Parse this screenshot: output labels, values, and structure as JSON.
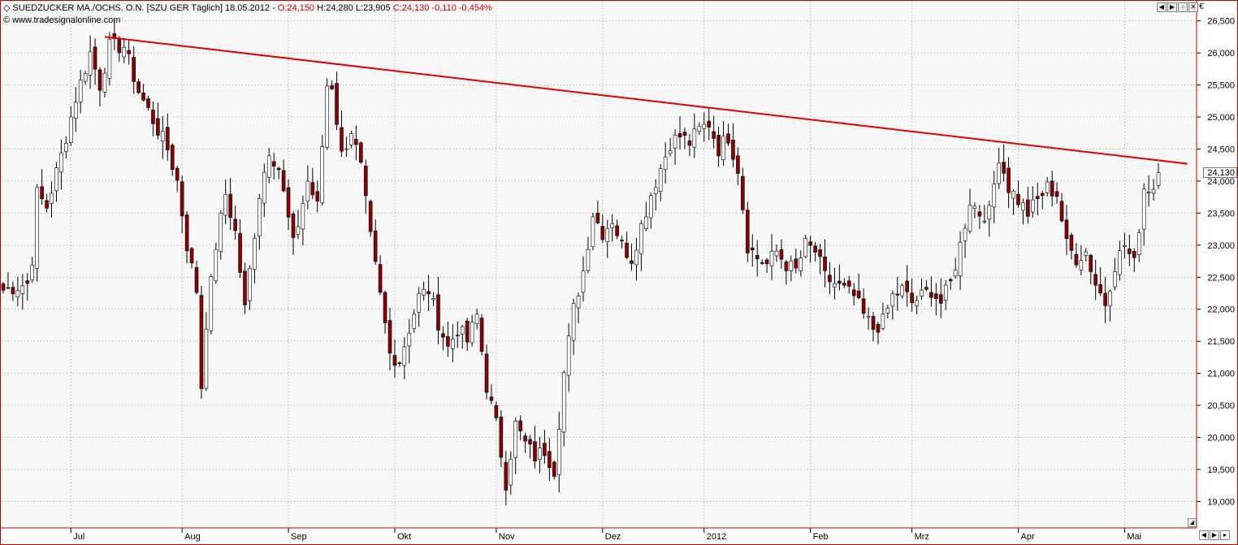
{
  "header": {
    "symbol": "SUEDZUCKER MA./OCHS. O.N.",
    "exchange": "[SZU GER  Täglich]",
    "date": "18.05.2012 -",
    "open": "O:24,150",
    "high": "H:24,280",
    "low": "L:23,905",
    "close_change": "C:24,130 -0,110 -0,454%"
  },
  "site": "www.tradesignalonline.com",
  "currency": "€",
  "last_price_label": "24,130",
  "colors": {
    "up": "#ffffff",
    "down": "#8b0000",
    "trendline": "#e00000",
    "border": "#c00000"
  },
  "chart_data": {
    "type": "candlestick",
    "ylim": [
      18600,
      26800
    ],
    "yticks": [
      19000,
      19500,
      20000,
      20500,
      21000,
      21500,
      22000,
      22500,
      23000,
      23500,
      24000,
      24500,
      25000,
      25500,
      26000,
      26500
    ],
    "ytick_labels": [
      "19,000",
      "19,500",
      "20,000",
      "20,500",
      "21,000",
      "21,500",
      "22,000",
      "22,500",
      "23,000",
      "23,500",
      "24,000",
      "24,500",
      "25,000",
      "25,500",
      "26,000",
      "26,500"
    ],
    "months": [
      {
        "label": "Jul",
        "day": 14
      },
      {
        "label": "Aug",
        "day": 37
      },
      {
        "label": "Sep",
        "day": 59
      },
      {
        "label": "Okt",
        "day": 81
      },
      {
        "label": "Nov",
        "day": 102
      },
      {
        "label": "Dez",
        "day": 124
      },
      {
        "label": "2012",
        "day": 145
      },
      {
        "label": "Feb",
        "day": 167
      },
      {
        "label": "Mrz",
        "day": 188
      },
      {
        "label": "Apr",
        "day": 210
      },
      {
        "label": "Mai",
        "day": 232
      }
    ],
    "total_days": 250,
    "trendline": {
      "from": [
        21,
        26250
      ],
      "to": [
        245,
        24270
      ]
    },
    "last_close": 24130,
    "anchors": [
      [
        0,
        22300
      ],
      [
        5,
        22400
      ],
      [
        6,
        22800
      ],
      [
        7,
        23800
      ],
      [
        9,
        23600
      ],
      [
        12,
        24400
      ],
      [
        15,
        25300
      ],
      [
        18,
        26000
      ],
      [
        20,
        25500
      ],
      [
        22,
        26100
      ],
      [
        25,
        26100
      ],
      [
        28,
        25400
      ],
      [
        30,
        25100
      ],
      [
        34,
        24500
      ],
      [
        36,
        24000
      ],
      [
        38,
        23000
      ],
      [
        40,
        22300
      ],
      [
        41,
        20800
      ],
      [
        42,
        21800
      ],
      [
        44,
        23000
      ],
      [
        46,
        23800
      ],
      [
        48,
        23200
      ],
      [
        50,
        22000
      ],
      [
        53,
        23800
      ],
      [
        55,
        24500
      ],
      [
        57,
        24200
      ],
      [
        60,
        23000
      ],
      [
        63,
        24000
      ],
      [
        65,
        23600
      ],
      [
        67,
        25500
      ],
      [
        68,
        25500
      ],
      [
        70,
        24400
      ],
      [
        72,
        24800
      ],
      [
        74,
        24200
      ],
      [
        76,
        23100
      ],
      [
        78,
        22200
      ],
      [
        80,
        21300
      ],
      [
        82,
        21200
      ],
      [
        84,
        21700
      ],
      [
        86,
        22200
      ],
      [
        88,
        22300
      ],
      [
        90,
        21800
      ],
      [
        92,
        21400
      ],
      [
        94,
        21700
      ],
      [
        96,
        21500
      ],
      [
        98,
        21900
      ],
      [
        100,
        20800
      ],
      [
        102,
        20200
      ],
      [
        104,
        19300
      ],
      [
        106,
        20200
      ],
      [
        108,
        19900
      ],
      [
        110,
        19700
      ],
      [
        112,
        19800
      ],
      [
        114,
        19500
      ],
      [
        116,
        21000
      ],
      [
        118,
        22000
      ],
      [
        120,
        22600
      ],
      [
        122,
        23500
      ],
      [
        124,
        23200
      ],
      [
        126,
        23400
      ],
      [
        128,
        23000
      ],
      [
        130,
        22800
      ],
      [
        132,
        23300
      ],
      [
        134,
        23800
      ],
      [
        136,
        24200
      ],
      [
        138,
        24600
      ],
      [
        140,
        24700
      ],
      [
        142,
        24600
      ],
      [
        144,
        24800
      ],
      [
        146,
        24900
      ],
      [
        148,
        24500
      ],
      [
        150,
        24700
      ],
      [
        152,
        24200
      ],
      [
        154,
        23000
      ],
      [
        156,
        22800
      ],
      [
        158,
        22700
      ],
      [
        160,
        22900
      ],
      [
        162,
        22700
      ],
      [
        164,
        22600
      ],
      [
        166,
        23000
      ],
      [
        168,
        22900
      ],
      [
        170,
        22500
      ],
      [
        172,
        22400
      ],
      [
        174,
        22300
      ],
      [
        176,
        22200
      ],
      [
        178,
        21900
      ],
      [
        180,
        21700
      ],
      [
        182,
        21800
      ],
      [
        184,
        22200
      ],
      [
        186,
        22300
      ],
      [
        188,
        22100
      ],
      [
        190,
        22200
      ],
      [
        192,
        22300
      ],
      [
        194,
        22100
      ],
      [
        196,
        22400
      ],
      [
        198,
        23000
      ],
      [
        200,
        23700
      ],
      [
        202,
        23500
      ],
      [
        204,
        23500
      ],
      [
        206,
        24400
      ],
      [
        208,
        23900
      ],
      [
        210,
        23700
      ],
      [
        212,
        23500
      ],
      [
        214,
        23700
      ],
      [
        216,
        23900
      ],
      [
        218,
        23800
      ],
      [
        220,
        23000
      ],
      [
        222,
        22800
      ],
      [
        224,
        22900
      ],
      [
        226,
        22400
      ],
      [
        228,
        22100
      ],
      [
        230,
        22700
      ],
      [
        232,
        23000
      ],
      [
        234,
        22700
      ],
      [
        236,
        23900
      ],
      [
        238,
        23900
      ],
      [
        239,
        24130
      ]
    ]
  }
}
